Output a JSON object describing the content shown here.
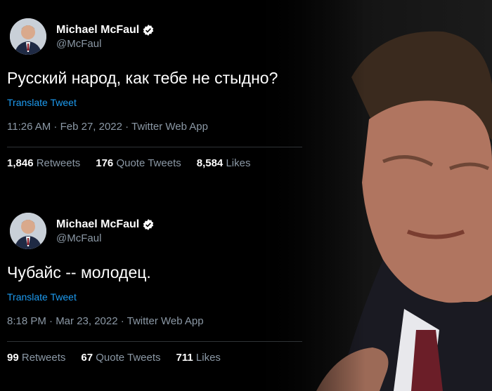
{
  "tweets": [
    {
      "author": {
        "display_name": "Michael McFaul",
        "handle": "@McFaul",
        "verified": true
      },
      "text": "Русский народ, как тебе не стыдно?",
      "translate_label": "Translate Tweet",
      "meta": "11:26 AM · Feb 27, 2022 · Twitter Web App",
      "stats": [
        {
          "count": "1,846",
          "label": "Retweets"
        },
        {
          "count": "176",
          "label": "Quote Tweets"
        },
        {
          "count": "8,584",
          "label": "Likes"
        }
      ]
    },
    {
      "author": {
        "display_name": "Michael McFaul",
        "handle": "@McFaul",
        "verified": true
      },
      "text": "Чубайс -- молодец.",
      "translate_label": "Translate Tweet",
      "meta": "8:18 PM · Mar 23, 2022 · Twitter Web App",
      "stats": [
        {
          "count": "99",
          "label": "Retweets"
        },
        {
          "count": "67",
          "label": "Quote Tweets"
        },
        {
          "count": "711",
          "label": "Likes"
        }
      ]
    }
  ],
  "icons": {
    "verified": "verified-badge-icon",
    "avatar": "profile-photo"
  },
  "colors": {
    "background": "#000000",
    "link": "#1d9bf0",
    "secondary_text": "#8b98a5"
  }
}
